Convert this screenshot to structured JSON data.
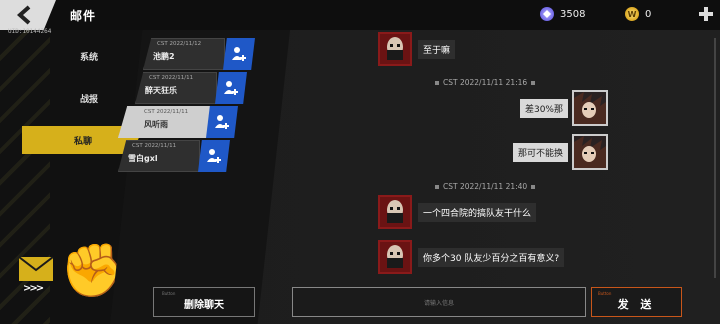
{
  "topbar": {
    "title": "邮件",
    "uid": "UID:10144264",
    "gems": "3508",
    "coins": "0",
    "coin_letter": "W"
  },
  "sidebar": {
    "items": [
      {
        "label": "系统",
        "active": false
      },
      {
        "label": "战报",
        "active": false
      },
      {
        "label": "私聊",
        "active": true
      }
    ]
  },
  "contacts": [
    {
      "date": "CST 2022/11/12",
      "name": "池鹏2",
      "active": false
    },
    {
      "date": "CST 2022/11/11",
      "name": "醉天狂乐",
      "active": false
    },
    {
      "date": "CST 2022/11/11",
      "name": "风听雨",
      "active": true
    },
    {
      "date": "CST 2022/11/11",
      "name": "雪白gxl",
      "active": false
    }
  ],
  "delete_button": {
    "label": "删除聊天",
    "small": "Button"
  },
  "chat": {
    "messages": [
      {
        "side": "left",
        "text": "至于嘛"
      },
      {
        "type": "time",
        "text": "CST 2022/11/11 21:16"
      },
      {
        "side": "right",
        "text": "差30%那"
      },
      {
        "side": "right",
        "text": "那可不能换"
      },
      {
        "type": "time",
        "text": "CST 2022/11/11 21:40"
      },
      {
        "side": "left",
        "text": "一个四合院的搞队友干什么"
      },
      {
        "side": "left",
        "text": "你多个30 队友少百分之百有意义?"
      }
    ]
  },
  "input": {
    "placeholder": "请输入信息"
  },
  "send_button": {
    "label": "发 送",
    "small": "Button"
  },
  "colors": {
    "accent_yellow": "#d6b01b",
    "add_blue": "#1f58c7",
    "send_orange": "#c8561a"
  }
}
